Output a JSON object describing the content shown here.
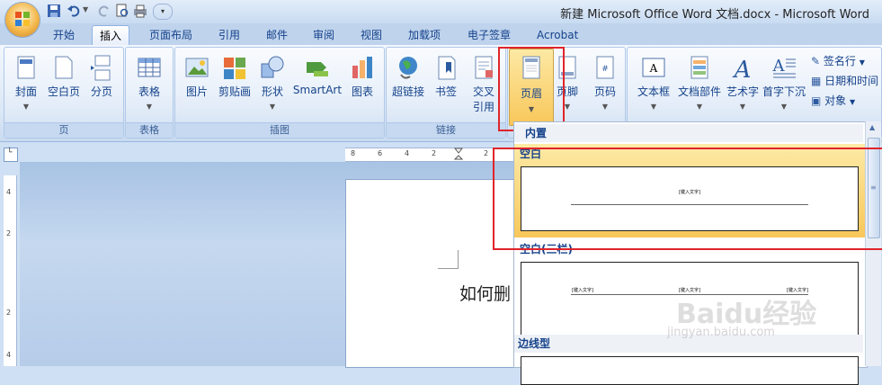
{
  "window": {
    "title": "新建 Microsoft Office Word 文档.docx - Microsoft Word"
  },
  "tabs": [
    "开始",
    "插入",
    "页面布局",
    "引用",
    "邮件",
    "审阅",
    "视图",
    "加载项",
    "电子签章",
    "Acrobat"
  ],
  "active_tab": "插入",
  "ribbon": {
    "pages": {
      "label": "页",
      "cover": "封面",
      "blank": "空白页",
      "break": "分页"
    },
    "tables": {
      "label": "表格",
      "table": "表格"
    },
    "illustrations": {
      "label": "插图",
      "picture": "图片",
      "clipart": "剪贴画",
      "shapes": "形状",
      "smartart": "SmartArt",
      "chart": "图表"
    },
    "links": {
      "label": "链接",
      "hyperlink": "超链接",
      "bookmark": "书签",
      "crossref_line1": "交叉",
      "crossref_line2": "引用"
    },
    "header_footer": {
      "header": "页眉",
      "footer": "页脚",
      "page_number": "页码"
    },
    "text": {
      "textbox": "文本框",
      "quickparts": "文档部件",
      "wordart": "艺术字",
      "dropcap": "首字下沉",
      "signature": "签名行",
      "datetime": "日期和时间",
      "object": "对象"
    }
  },
  "ruler": {
    "ticks": [
      "8",
      "6",
      "4",
      "2",
      "2"
    ]
  },
  "vruler": {
    "ticks": [
      "4",
      "2",
      "2",
      "4"
    ]
  },
  "document": {
    "visible_text": "如何删"
  },
  "gallery": {
    "section_builtin": "内置",
    "item1_title": "空白",
    "item1_placeholder": "[键入文字]",
    "item2_title": "空白(三栏)",
    "item2_placeholders": [
      "[键入文字]",
      "[键入文字]",
      "[键入文字]"
    ],
    "section3_title": "边线型"
  },
  "watermark": {
    "line1": "Baidu经验",
    "line2": "jingyan.baidu.com"
  },
  "colors": {
    "highlight_red": "#e0242a",
    "ribbon_text": "#15428b",
    "selected_item": "#f8c75a"
  }
}
